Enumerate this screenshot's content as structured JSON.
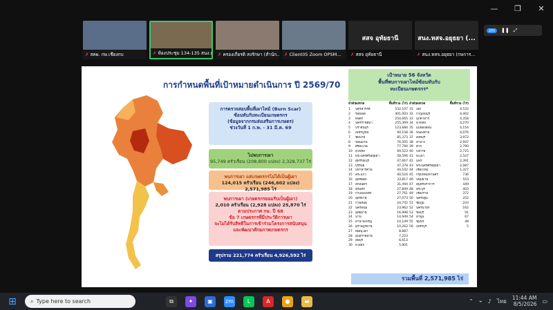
{
  "window": {
    "minimize": "—",
    "restore": "❐",
    "close": "✕"
  },
  "participants": [
    {
      "label": "สคผ. กษ.เชียงกบ",
      "color": "#5a6e8a"
    },
    {
      "label": "ห้องประชุม 134-135 สนง.กษ",
      "color": "#7a6a50",
      "active": true
    },
    {
      "label": "ครองเกียรติ สงรักษา (สำนัก...",
      "color": "#8a7a70"
    },
    {
      "label": "Client05 Zoom OPSM...",
      "color": "#6a7a8a"
    }
  ],
  "name_tiles": [
    {
      "big": "สสจ อุทัยธานี",
      "label": "สสจ อุทัยธานี"
    },
    {
      "big": "สนง.หสจ.อยุธยา (...",
      "label": "สนง.หสจ.อยุธยา (กษการ..."
    }
  ],
  "zoom_ctrl": {
    "logo": "zm",
    "text": ""
  },
  "slide": {
    "title": "การกำหนดพื้นที่เป้าหมายดำเนินการ ปี 2569/70",
    "blue_box": [
      "การตรวจสอบพื้นที่เผาไหม้ (Burn Scar)",
      "ซ้อนทับกับทะเบียนเกษตรกร",
      "(ข้อมูลจากกรมส่งเสริมการเกษตร)",
      "ช่วงวันที่ 1 ก.พ. - 31 มี.ค. 69"
    ],
    "green_box": [
      "ไม่พบการเผา",
      "95,749 ครัวเรือน (208,800 แปลง) 2,328,737 ไร่"
    ],
    "orange_box": [
      "พบการเผา แต่เกษตรกรไม่ได้เป็นผู้เผา",
      "124,015 ครัวเรือน (246,602 แปลง) 2,571,985 ไร่"
    ],
    "pink_box": [
      "พบการเผา (เกษตรกรยอมรับเป็นผู้เผา)",
      "2,010 ครัวเรือน (2,928 แปลง) 25,870 ไร่",
      "ตามประกาศ กษ. ปี 68",
      "ข้อ 7 เกษตรกรที่มีประวัติการเผา",
      "จะไม่ได้รับสิทธิในการเข้าร่วมโครงการสนับสนุน",
      "และพัฒนาศักยภาพเกษตรกร"
    ],
    "navy_box": "สรุปรวม 221,774 ครัวเรือน 4,926,592 ไร่",
    "panel_head": [
      "เป้าหมาย 56 จังหวัด",
      "พื้นที่พบการเผาไหม้ซ้อนทับกับ",
      "ทะเบียนเกษตรกร*"
    ],
    "table_headers": {
      "no": "ลำดับ",
      "prov": "จังหวัด",
      "area": "พื้นที่รวม (ไร่)"
    },
    "left_rows": [
      [
        "1",
        "นครสวรรค์",
        "532,107"
      ],
      [
        "2",
        "ร้อยเอ็ด",
        "401,003"
      ],
      [
        "3",
        "พิจิตร",
        "254,065"
      ],
      [
        "4",
        "นครราชสีมา",
        "255,369"
      ],
      [
        "5",
        "ปราจีนบุรี",
        "123,684"
      ],
      [
        "6",
        "เพชรบูรณ์",
        "90,158"
      ],
      [
        "7",
        "ชัยนาท",
        "85,373"
      ],
      [
        "8",
        "ขอนแก่น",
        "76,505"
      ],
      [
        "9",
        "ศรีสะเกษ",
        "77,794"
      ],
      [
        "10",
        "สุโขทัย",
        "69,523"
      ],
      [
        "11",
        "พระนครศรีอยุธยา",
        "58,596"
      ],
      [
        "12",
        "สุพรรณบุรี",
        "47,667"
      ],
      [
        "13",
        "บุรีรัมย์",
        "47,378"
      ],
      [
        "14",
        "มหาสารคาม",
        "44,102"
      ],
      [
        "15",
        "สระแก้ว",
        "40,524"
      ],
      [
        "16",
        "อุตรดิตถ์",
        "33,817"
      ],
      [
        "17",
        "สกลนคร",
        "31,494"
      ],
      [
        "18",
        "สุรินทร์",
        "27,849"
      ],
      [
        "19",
        "กำแพงเพชร",
        "27,761"
      ],
      [
        "20",
        "อุดรธานี",
        "27,073"
      ],
      [
        "21",
        "กาฬสินธุ์",
        "24,742"
      ],
      [
        "22",
        "นครพนม",
        "23,962"
      ],
      [
        "23",
        "อุทัยธานี",
        "16,998"
      ],
      [
        "24",
        "น่าน",
        "14,949"
      ],
      [
        "25",
        "อำนาจเจริญ",
        "14,149"
      ],
      [
        "26",
        "สุราษฎร์ธานี",
        "10,262"
      ],
      [
        "27",
        "พิษณุโลก",
        "8,887"
      ],
      [
        "28",
        "อุบลราชธานี",
        "7,223"
      ],
      [
        "29",
        "ลพบุรี",
        "6,613"
      ],
      [
        "30",
        "ยโสธร",
        "5,901"
      ]
    ],
    "right_rows": [
      [
        "31",
        "เลย",
        "4,532"
      ],
      [
        "32",
        "กาญจนบุรี",
        "4,402"
      ],
      [
        "33",
        "มุกดาหาร",
        "4,358"
      ],
      [
        "34",
        "สุโขทัย",
        "4,270"
      ],
      [
        "35",
        "แม่ฮ่องสอน",
        "4,154"
      ],
      [
        "36",
        "หนองคาย",
        "4,076"
      ],
      [
        "37",
        "สิงห์บุรี",
        "3,972"
      ],
      [
        "38",
        "ลำปาง",
        "2,947"
      ],
      [
        "39",
        "ตาก",
        "2,790"
      ],
      [
        "40",
        "บึงกาฬ",
        "2,725"
      ],
      [
        "41",
        "พะเยา",
        "2,547"
      ],
      [
        "42",
        "แพร่",
        "2,391"
      ],
      [
        "43",
        "พระนครศรีอยุธยา",
        "2,087"
      ],
      [
        "44",
        "เชียงใหม่",
        "1,327"
      ],
      [
        "45",
        "กรุงเทพมหานคร",
        "736"
      ],
      [
        "46",
        "ปทุมธานี",
        "553"
      ],
      [
        "47",
        "สมุทรปราการ",
        "449"
      ],
      [
        "48",
        "สระบุรี",
        "403"
      ],
      [
        "49",
        "เชียงราย",
        "372"
      ],
      [
        "50",
        "นครปฐม",
        "252"
      ],
      [
        "51",
        "ชัยภูมิ",
        "243"
      ],
      [
        "52",
        "นครนายก",
        "162"
      ],
      [
        "53",
        "ชลบุรี",
        "91"
      ],
      [
        "54",
        "ลำพูน",
        "67"
      ],
      [
        "55",
        "ชุมพร",
        "48"
      ],
      [
        "56",
        "เพชรบุรี",
        "5"
      ]
    ],
    "total": "รวมพื้นที่ 2,571,985 ไร่"
  },
  "taskbar": {
    "search_placeholder": "Type here to search",
    "apps": [
      {
        "name": "task-view-icon",
        "glyph": "⧉",
        "bg": "#333"
      },
      {
        "name": "copilot-icon",
        "glyph": "✦",
        "bg": "#7a4be0"
      },
      {
        "name": "store-icon",
        "glyph": "▣",
        "bg": "#2e6bd6"
      },
      {
        "name": "zoom-icon",
        "glyph": "zm",
        "bg": "#2d8cff"
      },
      {
        "name": "line-icon",
        "glyph": "L",
        "bg": "#06c755"
      },
      {
        "name": "pdf-icon",
        "glyph": "A",
        "bg": "#d62828"
      },
      {
        "name": "chrome-icon",
        "glyph": "●",
        "bg": "#e8a317"
      },
      {
        "name": "folder-icon",
        "glyph": "▬",
        "bg": "#e9b949"
      }
    ],
    "lang": "ไทย",
    "time": "11:44 AM",
    "date": "8/5/2026"
  }
}
